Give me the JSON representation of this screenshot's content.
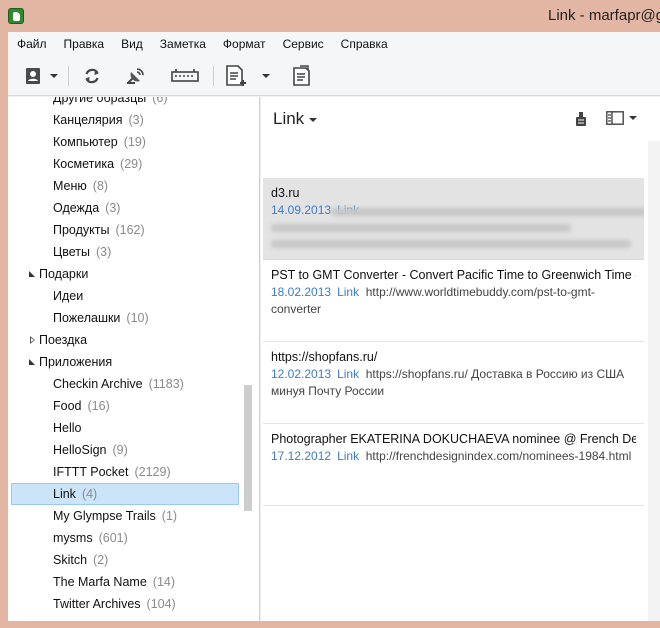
{
  "window": {
    "title": "Link - marfapr@g"
  },
  "menu": [
    "Файл",
    "Правка",
    "Вид",
    "Заметка",
    "Формат",
    "Сервис",
    "Справка"
  ],
  "toolbar": {
    "buttons": [
      "account-icon",
      "sync-icon",
      "workchat-icon",
      "presentation-icon",
      "new-note-icon",
      "note-attributes-icon"
    ]
  },
  "sidebar": {
    "items": [
      {
        "label": "Другие образцы",
        "count": "(6)",
        "level": 2
      },
      {
        "label": "Канцелярия",
        "count": "(3)",
        "level": 2
      },
      {
        "label": "Компьютер",
        "count": "(19)",
        "level": 2
      },
      {
        "label": "Косметика",
        "count": "(29)",
        "level": 2
      },
      {
        "label": "Меню",
        "count": "(8)",
        "level": 2
      },
      {
        "label": "Одежда",
        "count": "(3)",
        "level": 2
      },
      {
        "label": "Продукты",
        "count": "(162)",
        "level": 2
      },
      {
        "label": "Цветы",
        "count": "(3)",
        "level": 2
      },
      {
        "label": "Подарки",
        "count": "",
        "level": 1,
        "toggle": "open"
      },
      {
        "label": "Идеи",
        "count": "",
        "level": 2
      },
      {
        "label": "Пожелашки",
        "count": "(10)",
        "level": 2
      },
      {
        "label": "Поездка",
        "count": "",
        "level": 1,
        "toggle": "closed"
      },
      {
        "label": "Приложения",
        "count": "",
        "level": 1,
        "toggle": "open"
      },
      {
        "label": "Checkin Archive",
        "count": "(1183)",
        "level": 2
      },
      {
        "label": "Food",
        "count": "(16)",
        "level": 2
      },
      {
        "label": "Hello",
        "count": "",
        "level": 2
      },
      {
        "label": "HelloSign",
        "count": "(9)",
        "level": 2
      },
      {
        "label": "IFTTT Pocket",
        "count": "(2129)",
        "level": 2
      },
      {
        "label": "Link",
        "count": "(4)",
        "level": 2,
        "selected": true
      },
      {
        "label": "My Glympse Trails",
        "count": "(1)",
        "level": 2
      },
      {
        "label": "mysms",
        "count": "(601)",
        "level": 2
      },
      {
        "label": "Skitch",
        "count": "(2)",
        "level": 2
      },
      {
        "label": "The Marfa Name",
        "count": "(14)",
        "level": 2
      },
      {
        "label": "Twitter Archives",
        "count": "(104)",
        "level": 2
      }
    ]
  },
  "notelist": {
    "title": "Link",
    "notes": [
      {
        "title": "d3.ru",
        "date": "14.09.2013",
        "tag": "Link",
        "snippet": "",
        "blurred": true
      },
      {
        "title": "PST to GMT Converter - Convert Pacific Time to Greenwich Time - ...",
        "date": "18.02.2013",
        "tag": "Link",
        "snippet": "http://www.worldtimebuddy.com/pst-to-gmt-converter"
      },
      {
        "title": "https://shopfans.ru/",
        "date": "12.02.2013",
        "tag": "Link",
        "snippet": "https://shopfans.ru/ Доставка в Россию из США минуя Почту России"
      },
      {
        "title": "Photographer EKATERINA DOKUCHAEVA nominee @ French Design...",
        "date": "17.12.2012",
        "tag": "Link",
        "snippet": "http://frenchdesignindex.com/nominees-1984.html"
      }
    ]
  },
  "colors": {
    "accent": "#3d7cc9",
    "selection": "#cce4f7",
    "title_bar": "#e3b6a4"
  }
}
